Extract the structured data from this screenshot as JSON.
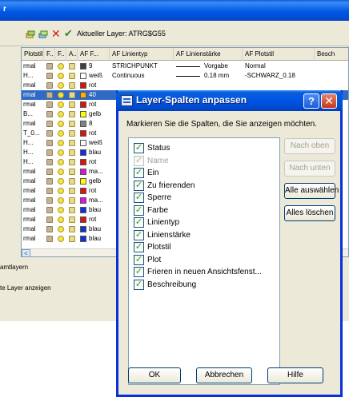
{
  "toolbar": {
    "current_layer_label": "Aktueller Layer: ATRG$G55"
  },
  "grid": {
    "headers": [
      "Plotstil",
      "F..",
      "F..",
      "A..",
      "AF F...",
      "AF Linientyp",
      "AF Linienstärke",
      "AF Plotstil",
      "Besch"
    ],
    "rows": [
      {
        "a": "rmal",
        "color": "9",
        "swatch": "#404040",
        "ltype": "STRICHPUNKT",
        "lweight": "Vorgabe",
        "pstyle": "Normal",
        "selected": false
      },
      {
        "a": "H...",
        "color": "weiß",
        "swatch": "#ffffff",
        "ltype": "Continuous",
        "lweight": "0.18 mm",
        "pstyle": "-SCHWARZ_0.18",
        "selected": false
      },
      {
        "a": "rmal",
        "color": "rot",
        "swatch": "#e01010",
        "ltype": "",
        "lweight": "",
        "pstyle": "",
        "selected": false
      },
      {
        "a": "rmal",
        "color": "40",
        "swatch": "#ffb000",
        "ltype": "",
        "lweight": "",
        "pstyle": "",
        "selected": true
      },
      {
        "a": "rmal",
        "color": "rot",
        "swatch": "#e01010",
        "ltype": "",
        "lweight": "",
        "pstyle": "",
        "selected": false
      },
      {
        "a": "B...",
        "color": "gelb",
        "swatch": "#ffff00",
        "ltype": "",
        "lweight": "",
        "pstyle": "",
        "selected": false
      },
      {
        "a": "rmal",
        "color": "8",
        "swatch": "#808080",
        "ltype": "",
        "lweight": "",
        "pstyle": "",
        "selected": false
      },
      {
        "a": "T_0...",
        "color": "rot",
        "swatch": "#e01010",
        "ltype": "",
        "lweight": "",
        "pstyle": "",
        "selected": false
      },
      {
        "a": "H...",
        "color": "weiß",
        "swatch": "#ffffff",
        "ltype": "",
        "lweight": "",
        "pstyle": "",
        "selected": false
      },
      {
        "a": "H...",
        "color": "blau",
        "swatch": "#1030e0",
        "ltype": "",
        "lweight": "",
        "pstyle": "",
        "selected": false
      },
      {
        "a": "H...",
        "color": "rot",
        "swatch": "#e01010",
        "ltype": "",
        "lweight": "",
        "pstyle": "",
        "selected": false
      },
      {
        "a": "rmal",
        "color": "ma...",
        "swatch": "#e010e0",
        "ltype": "",
        "lweight": "",
        "pstyle": "",
        "selected": false
      },
      {
        "a": "rmal",
        "color": "gelb",
        "swatch": "#ffff00",
        "ltype": "",
        "lweight": "",
        "pstyle": "",
        "selected": false
      },
      {
        "a": "rmal",
        "color": "rot",
        "swatch": "#e01010",
        "ltype": "",
        "lweight": "",
        "pstyle": "",
        "selected": false
      },
      {
        "a": "rmal",
        "color": "ma...",
        "swatch": "#e010e0",
        "ltype": "",
        "lweight": "",
        "pstyle": "",
        "selected": false
      },
      {
        "a": "rmal",
        "color": "blau",
        "swatch": "#1030e0",
        "ltype": "",
        "lweight": "",
        "pstyle": "",
        "selected": false
      },
      {
        "a": "rmal",
        "color": "rot",
        "swatch": "#e01010",
        "ltype": "",
        "lweight": "",
        "pstyle": "",
        "selected": false
      },
      {
        "a": "rmal",
        "color": "blau",
        "swatch": "#1030e0",
        "ltype": "",
        "lweight": "",
        "pstyle": "",
        "selected": false
      },
      {
        "a": "rmal",
        "color": "blau",
        "swatch": "#1030e0",
        "ltype": "",
        "lweight": "",
        "pstyle": "",
        "selected": false
      }
    ],
    "scroll_left_glyph": "<"
  },
  "status": {
    "line1": "amtlayern",
    "line2": "te Layer anzeigen"
  },
  "dialog": {
    "title": "Layer-Spalten anpassen",
    "help_glyph": "?",
    "close_glyph": "✕",
    "instruction": "Markieren Sie die Spalten, die Sie anzeigen möchten.",
    "columns": [
      {
        "label": "Status",
        "checked": true,
        "disabled": false
      },
      {
        "label": "Name",
        "checked": true,
        "disabled": true
      },
      {
        "label": "Ein",
        "checked": true,
        "disabled": false
      },
      {
        "label": "Zu frierenden",
        "checked": true,
        "disabled": false
      },
      {
        "label": "Sperre",
        "checked": true,
        "disabled": false
      },
      {
        "label": "Farbe",
        "checked": true,
        "disabled": false
      },
      {
        "label": "Linientyp",
        "checked": true,
        "disabled": false
      },
      {
        "label": "Linienstärke",
        "checked": true,
        "disabled": false
      },
      {
        "label": "Plotstil",
        "checked": true,
        "disabled": false
      },
      {
        "label": "Plot",
        "checked": true,
        "disabled": false
      },
      {
        "label": "Frieren in neuen Ansichtsfenst...",
        "checked": true,
        "disabled": false
      },
      {
        "label": "Beschreibung",
        "checked": true,
        "disabled": false
      }
    ],
    "buttons": {
      "move_up": "Nach oben",
      "move_down": "Nach unten",
      "select_all": "Alle auswählen",
      "clear_all": "Alles löschen",
      "ok": "OK",
      "cancel": "Abbrechen",
      "help": "Hilfe"
    }
  }
}
